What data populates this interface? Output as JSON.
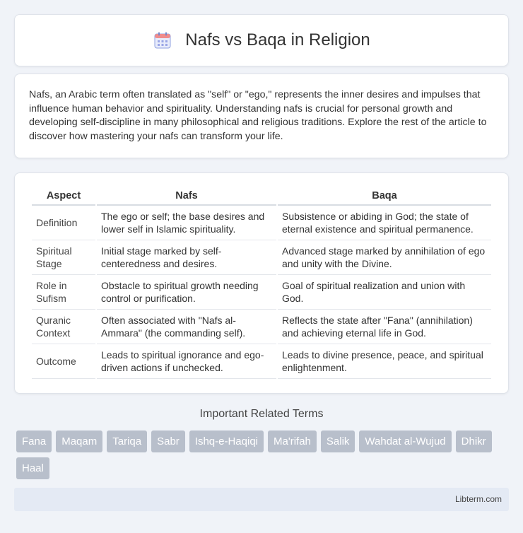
{
  "header": {
    "title": "Nafs vs Baqa in Religion",
    "icon": "calendar-icon"
  },
  "intro": {
    "text": "Nafs, an Arabic term often translated as \"self\" or \"ego,\" represents the inner desires and impulses that influence human behavior and spirituality. Understanding nafs is crucial for personal growth and developing self-discipline in many philosophical and religious traditions. Explore the rest of the article to discover how mastering your nafs can transform your life."
  },
  "table": {
    "headers": [
      "Aspect",
      "Nafs",
      "Baqa"
    ],
    "rows": [
      [
        "Definition",
        "The ego or self; the base desires and lower self in Islamic spirituality.",
        "Subsistence or abiding in God; the state of eternal existence and spiritual permanence."
      ],
      [
        "Spiritual Stage",
        "Initial stage marked by self-centeredness and desires.",
        "Advanced stage marked by annihilation of ego and unity with the Divine."
      ],
      [
        "Role in Sufism",
        "Obstacle to spiritual growth needing control or purification.",
        "Goal of spiritual realization and union with God."
      ],
      [
        "Quranic Context",
        "Often associated with \"Nafs al-Ammara\" (the commanding self).",
        "Reflects the state after \"Fana\" (annihilation) and achieving eternal life in God."
      ],
      [
        "Outcome",
        "Leads to spiritual ignorance and ego-driven actions if unchecked.",
        "Leads to divine presence, peace, and spiritual enlightenment."
      ]
    ]
  },
  "related": {
    "title": "Important Related Terms",
    "tags": [
      "Fana",
      "Maqam",
      "Tariqa",
      "Sabr",
      "Ishq-e-Haqiqi",
      "Ma'rifah",
      "Salik",
      "Wahdat al-Wujud",
      "Dhikr",
      "Haal"
    ]
  },
  "footer": {
    "text": "Libterm.com"
  },
  "colors": {
    "accent": "#b8bfcb",
    "background": "#f0f3f8",
    "footer_bg": "#e4eaf4"
  }
}
